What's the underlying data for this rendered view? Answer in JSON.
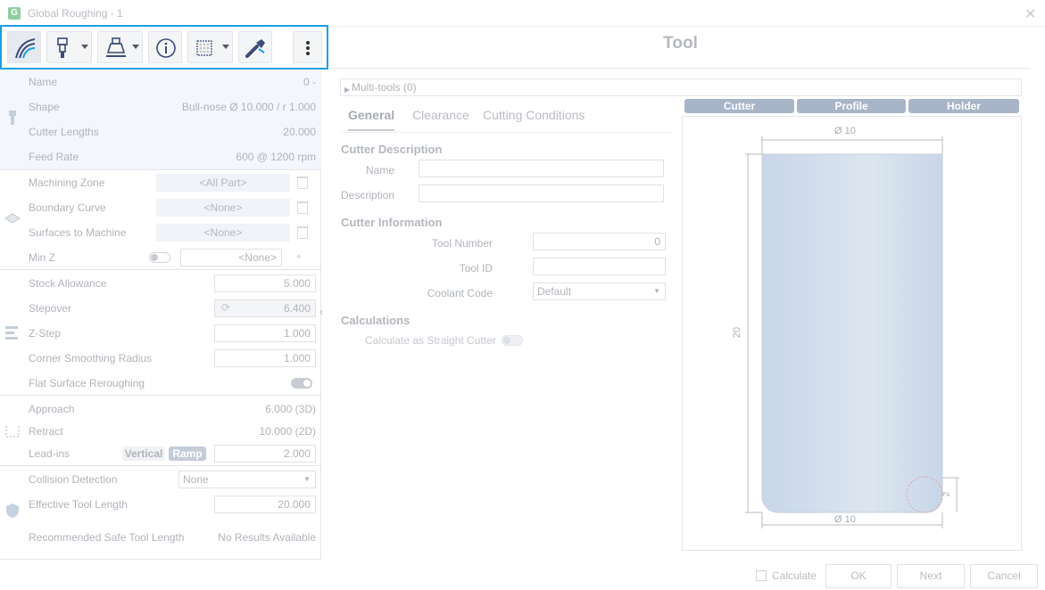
{
  "window": {
    "title": "Global Roughing - 1",
    "close_glyph": "✕",
    "app_glyph": "G"
  },
  "toolbar": {
    "buttons": [
      {
        "name": "toolpath-button",
        "icon": "toolpath-icon"
      },
      {
        "name": "tool-button",
        "icon": "tool-icon",
        "dropdown": true
      },
      {
        "name": "holder-button",
        "icon": "holder-icon",
        "dropdown": true
      },
      {
        "name": "info-button",
        "icon": "info-icon"
      },
      {
        "name": "pattern-button",
        "icon": "pattern-icon",
        "dropdown": true
      },
      {
        "name": "wrench-button",
        "icon": "wrench-icon"
      },
      {
        "name": "more-button",
        "icon": "more-vertical-icon"
      }
    ]
  },
  "panel_title": "Tool",
  "tool_group": {
    "name_label": "Name",
    "name_value": "0 -",
    "shape_label": "Shape",
    "shape_value": "Bull-nose Ø 10.000 / r 1.000",
    "lengths_label": "Cutter Lengths",
    "lengths_value": "20.000",
    "feed_label": "Feed Rate",
    "feed_value": "600 @ 1200 rpm"
  },
  "zone_group": {
    "machining_zone_label": "Machining Zone",
    "machining_zone_value": "<All Part>",
    "boundary_label": "Boundary Curve",
    "boundary_value": "<None>",
    "surfaces_label": "Surfaces to Machine",
    "surfaces_value": "<None>",
    "minz_label": "Min Z",
    "minz_value": "<None>"
  },
  "params_group": {
    "stock_label": "Stock Allowance",
    "stock_value": "5.000",
    "stepover_label": "Stepover",
    "stepover_value": "6.400",
    "zstep_label": "Z-Step",
    "zstep_value": "1.000",
    "corner_label": "Corner Smoothing Radius",
    "corner_value": "1.000",
    "flat_label": "Flat Surface Reroughing",
    "flat_on": true
  },
  "links_group": {
    "approach_label": "Approach",
    "approach_value": "6.000 (3D)",
    "retract_label": "Retract",
    "retract_value": "10.000 (2D)",
    "leadins_label": "Lead-ins",
    "leadins_opt1": "Vertical",
    "leadins_opt2": "Ramp",
    "leadins_value": "2.000"
  },
  "collision_group": {
    "collision_label": "Collision Detection",
    "collision_value": "None",
    "efflen_label": "Effective Tool Length",
    "efflen_value": "20.000",
    "rec_label": "Recommended Safe Tool Length",
    "rec_value": "No Results Available"
  },
  "right": {
    "multitools": "Multi-tools (0)",
    "tabs": [
      "General",
      "Clearance",
      "Cutting Conditions"
    ],
    "cutter_desc_heading": "Cutter Description",
    "name_label": "Name",
    "name_value": "",
    "desc_label": "Description",
    "desc_value": "",
    "cutter_info_heading": "Cutter Information",
    "toolnum_label": "Tool Number",
    "toolnum_value": "0",
    "toolid_label": "Tool ID",
    "toolid_value": "",
    "coolant_label": "Coolant Code",
    "coolant_value": "Default",
    "calc_heading": "Calculations",
    "calc_straight_label": "Calculate as Straight Cutter"
  },
  "preview": {
    "segments": [
      "Cutter",
      "Profile",
      "Holder"
    ],
    "top_dim": "Ø 10",
    "bottom_dim": "Ø 10",
    "height_dim": "20",
    "radius_dim": "2"
  },
  "footer": {
    "calculate_label": "Calculate",
    "ok": "OK",
    "next": "Next",
    "cancel": "Cancel"
  }
}
